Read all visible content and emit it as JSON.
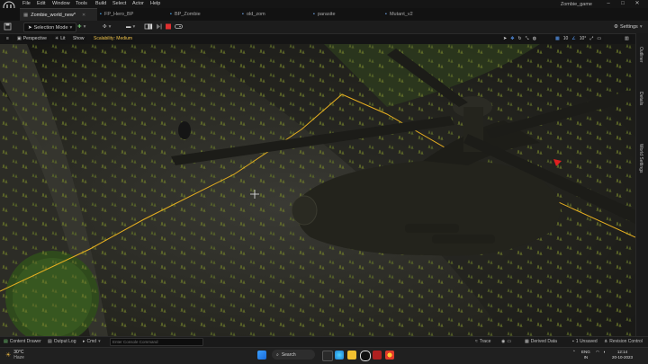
{
  "menu": {
    "items": [
      "File",
      "Edit",
      "Window",
      "Tools",
      "Build",
      "Select",
      "Actor",
      "Help"
    ],
    "app_title": "Zombie_game"
  },
  "tabs": [
    {
      "label": "Zombie_world_new*",
      "active": true
    },
    {
      "label": "FP_Hero_BP",
      "active": false
    },
    {
      "label": "BP_Zombie",
      "active": false
    },
    {
      "label": "old_zom",
      "active": false
    },
    {
      "label": "parasite",
      "active": false
    },
    {
      "label": "Mutant_v2",
      "active": false
    }
  ],
  "toolbar": {
    "selection_mode": "Selection Mode",
    "settings": "Settings"
  },
  "viewport_header": {
    "perspective": "Perspective",
    "lit": "Lit",
    "show": "Show",
    "scalability": "Scalability: Medium"
  },
  "side_rail": {
    "outliner": "Outliner",
    "details": "Details",
    "world_settings": "World Settings"
  },
  "status_bar": {
    "content_drawer": "Content Drawer",
    "output_log": "Output Log",
    "cmd": "Cmd",
    "console_placeholder": "Enter Console Command",
    "trace": "Trace",
    "derived_data": "Derived Data",
    "unsaved": "1 Unsaved",
    "revision_control": "Revision Control"
  },
  "taskbar": {
    "weather_temp": "30°C",
    "weather_desc": "Haze",
    "search": "Search",
    "lang_top": "ENG",
    "lang_bottom": "IN",
    "time": "12:14",
    "date": "20-10-2023"
  },
  "colors": {
    "selection_outline": "#e8b020",
    "scalability_text": "#f0c44a",
    "stop_button": "#e03030",
    "play_button": "#4fc14f"
  }
}
